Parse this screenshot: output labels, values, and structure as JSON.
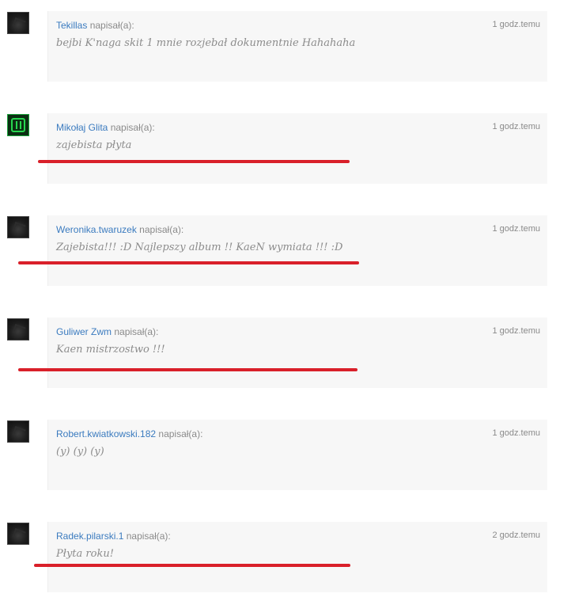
{
  "comments": [
    {
      "author": "Tekillas",
      "wrote_label": "napisał(a):",
      "time": "1 godz.temu",
      "text": "bejbi K'naga skit 1 mnie rozjebał dokumentnie Hahahaha",
      "avatar": "dark-avatar-icon"
    },
    {
      "author": "Mikołaj Glita",
      "wrote_label": "napisał(a):",
      "time": "1 godz.temu",
      "text": "zajebista płyta",
      "avatar": "green-avatar-icon"
    },
    {
      "author": "Weronika.twaruzek",
      "wrote_label": "napisał(a):",
      "time": "1 godz.temu",
      "text": "Zajebista!!! :D Najlepszy album !! KaeN wymiata !!! :D",
      "avatar": "dark-avatar-icon"
    },
    {
      "author": "Guliwer Zwm",
      "wrote_label": "napisał(a):",
      "time": "1 godz.temu",
      "text": "Kaen mistrzostwo !!!",
      "avatar": "dark-avatar-icon"
    },
    {
      "author": "Robert.kwiatkowski.182",
      "wrote_label": "napisał(a):",
      "time": "1 godz.temu",
      "text": "(y) (y) (y)",
      "avatar": "dark-avatar-icon"
    },
    {
      "author": "Radek.pilarski.1",
      "wrote_label": "napisał(a):",
      "time": "2 godz.temu",
      "text": "Płyta roku!",
      "avatar": "dark-avatar-icon"
    }
  ],
  "colors": {
    "author_link": "#3b7bbf",
    "underline_annotation": "#d9202a",
    "bubble_background": "#f7f7f7"
  }
}
